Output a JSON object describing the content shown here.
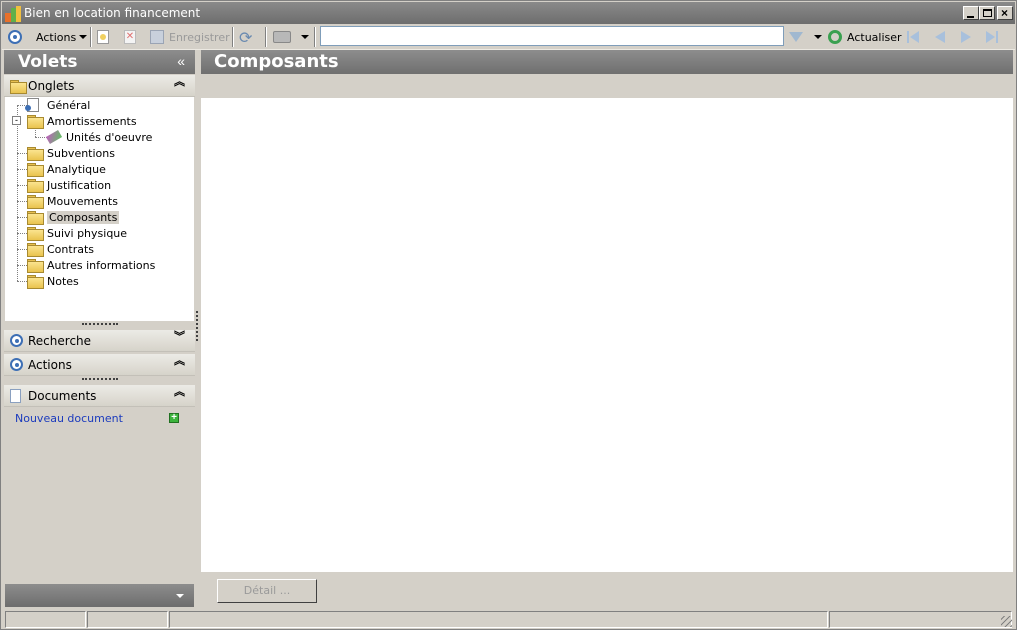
{
  "window": {
    "title": "Bien en location financement"
  },
  "toolbar": {
    "actions_label": "Actions",
    "save_label": "Enregistrer",
    "search_value": "",
    "refresh_label": "Actualiser"
  },
  "left_panel": {
    "title": "Volets",
    "collapse_glyph": "«",
    "onglets": {
      "label": "Onglets",
      "items": [
        {
          "label": "Général"
        },
        {
          "label": "Amortissements"
        },
        {
          "label": "Unités d'oeuvre"
        },
        {
          "label": "Subventions"
        },
        {
          "label": "Analytique"
        },
        {
          "label": "Justification"
        },
        {
          "label": "Mouvements"
        },
        {
          "label": "Composants"
        },
        {
          "label": "Suivi physique"
        },
        {
          "label": "Contrats"
        },
        {
          "label": "Autres informations"
        },
        {
          "label": "Notes"
        }
      ]
    },
    "recherche_label": "Recherche",
    "actions_label": "Actions",
    "documents_label": "Documents",
    "new_document_label": "Nouveau document"
  },
  "main": {
    "title": "Composants",
    "detail_button_label": "Détail ..."
  },
  "colors": {
    "header_gray": "#7a7a7a",
    "link_blue": "#1c3bbd",
    "accent_blue": "#3d6fb5"
  }
}
